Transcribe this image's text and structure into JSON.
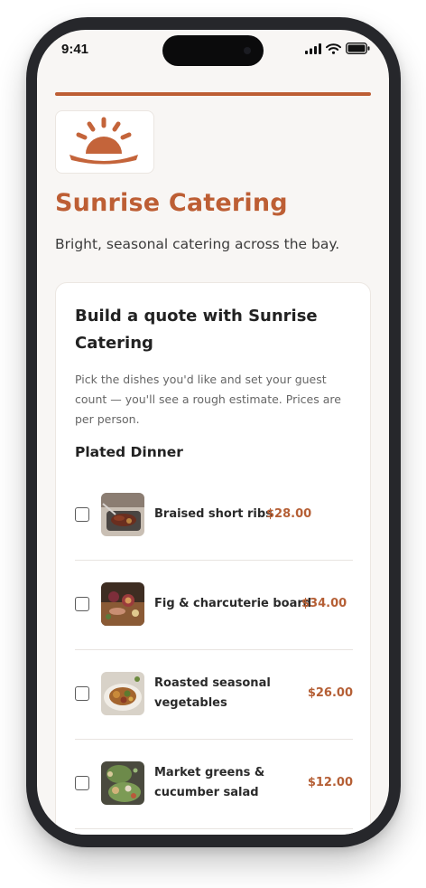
{
  "status_bar": {
    "time": "9:41"
  },
  "brand": {
    "name": "Sunrise Catering",
    "tagline": "Bright, seasonal catering across the bay.",
    "accent_color": "#bd5e34"
  },
  "quote_card": {
    "title": "Build a quote with Sunrise Catering",
    "description": "Pick the dishes you'd like and set your guest count — you'll see a rough estimate. Prices are per person.",
    "section_title": "Plated Dinner",
    "items": [
      {
        "name": "Braised short ribs",
        "price": "$28.00",
        "checked": false,
        "thumb_icon": "short-ribs-photo"
      },
      {
        "name": "Fig & charcuterie board",
        "price": "$34.00",
        "checked": false,
        "thumb_icon": "charcuterie-photo"
      },
      {
        "name": "Roasted seasonal vegetables",
        "price": "$26.00",
        "checked": false,
        "thumb_icon": "vegetables-photo"
      },
      {
        "name": "Market greens & cucumber salad",
        "price": "$12.00",
        "checked": false,
        "thumb_icon": "salad-photo"
      }
    ]
  }
}
